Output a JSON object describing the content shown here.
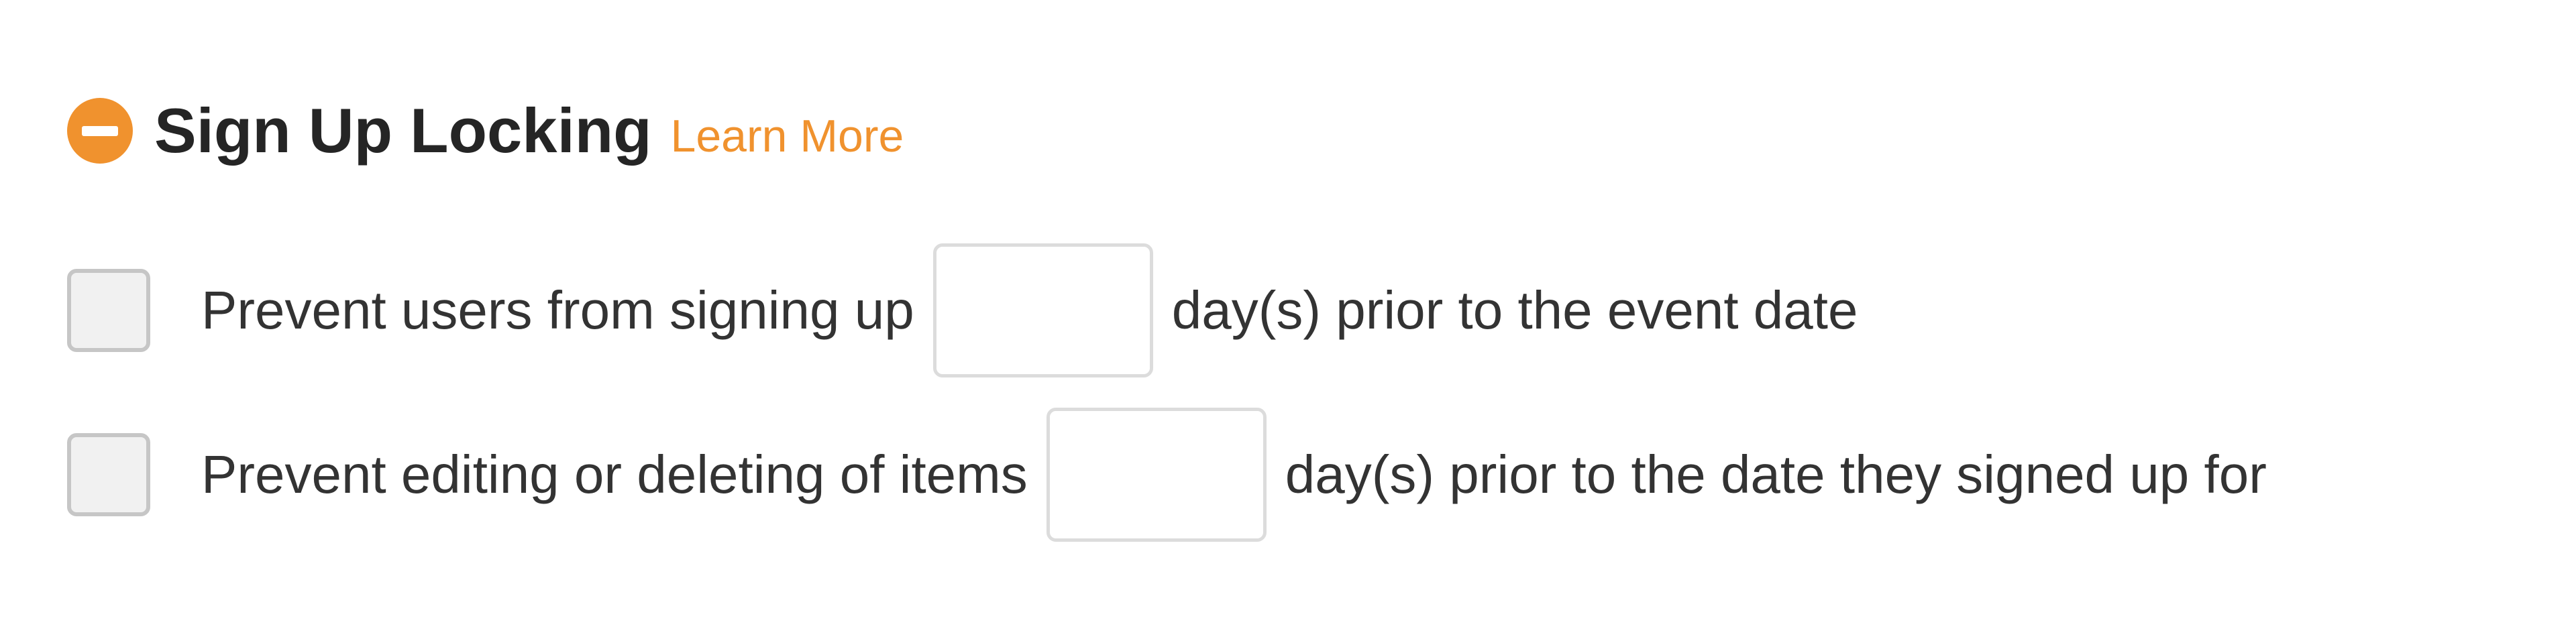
{
  "section": {
    "title": "Sign Up Locking",
    "learn_more_label": "Learn More",
    "collapse_icon": "minus-circle-icon"
  },
  "options": [
    {
      "checked": false,
      "label_before": "Prevent users from signing up",
      "days_value": "",
      "label_after": "day(s) prior to the event date"
    },
    {
      "checked": false,
      "label_before": "Prevent editing or deleting of items",
      "days_value": "",
      "label_after": "day(s) prior to the date they signed up for"
    }
  ],
  "colors": {
    "accent": "#f0922e",
    "title_text": "#252525",
    "body_text": "#333333",
    "checkbox_fill": "#f1f1f1",
    "checkbox_border": "#c6c6c6",
    "input_border": "#dcdcdc"
  }
}
